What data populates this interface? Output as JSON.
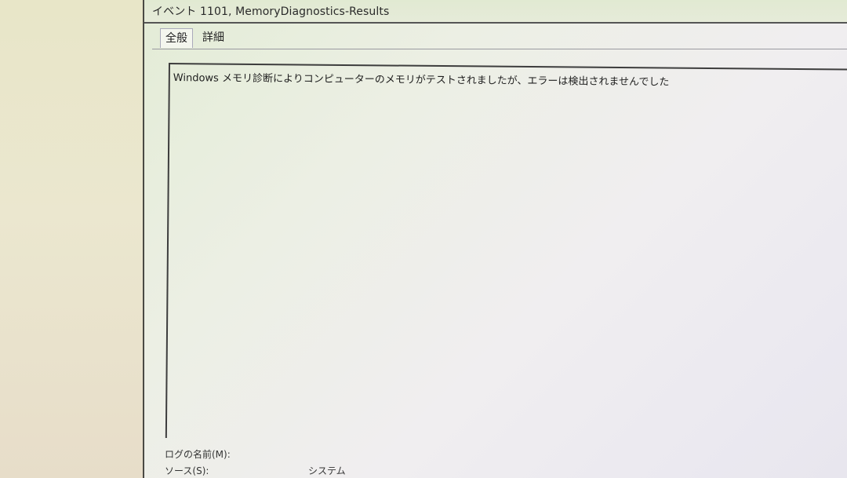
{
  "window": {
    "title": "イベント 1101, MemoryDiagnostics-Results"
  },
  "tabs": [
    {
      "label": "全般"
    },
    {
      "label": "詳細"
    }
  ],
  "message": {
    "text": "Windows メモリ診断によりコンピューターのメモリがテストされましたが、エラーは検出されませんでした"
  },
  "fields": {
    "log_name_label": "ログの名前(M):",
    "source_label": "ソース(S):",
    "source_value": "システム"
  }
}
